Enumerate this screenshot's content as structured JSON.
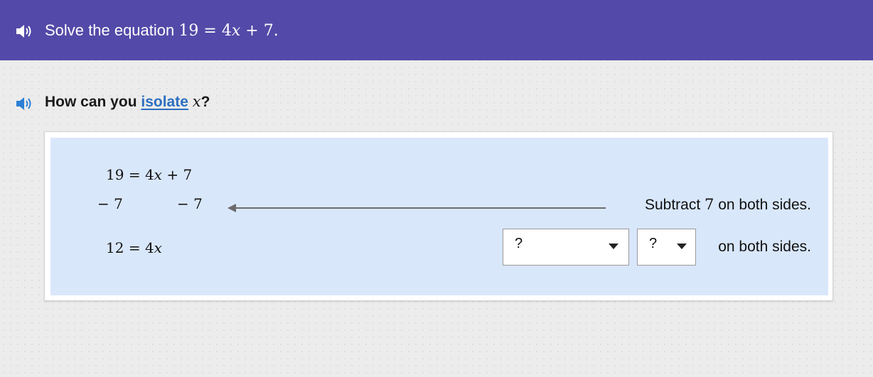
{
  "header": {
    "speaker_icon": "speaker-icon",
    "prompt_prefix": "Solve the equation",
    "equation": {
      "lhs": "19",
      "eq": "=",
      "coef": "4",
      "var": "x",
      "plus": "+",
      "const": "7",
      "period": "."
    }
  },
  "question": {
    "speaker_icon": "speaker-icon",
    "prefix": "How can you",
    "link_text": "isolate",
    "variable": "x",
    "suffix": "?"
  },
  "work": {
    "line1": {
      "lhs": "19",
      "eq": "=",
      "coef": "4",
      "var": "x",
      "plus": "+",
      "const": "7"
    },
    "line2": {
      "left": "− 7",
      "right": "− 7"
    },
    "line3": {
      "lhs": "12",
      "eq": "=",
      "coef": "4",
      "var": "x"
    },
    "step1": {
      "prefix": "Subtract",
      "num": "7",
      "suffix": "on both sides."
    },
    "step2": {
      "operation_dropdown": {
        "selected": "?"
      },
      "value_dropdown": {
        "selected": "?"
      },
      "suffix": "on both sides."
    }
  },
  "colors": {
    "header_bg": "#5349a8",
    "panel_bg": "#d9e7fb",
    "link": "#2c6fbf",
    "speaker_blue": "#2c7fd6"
  }
}
